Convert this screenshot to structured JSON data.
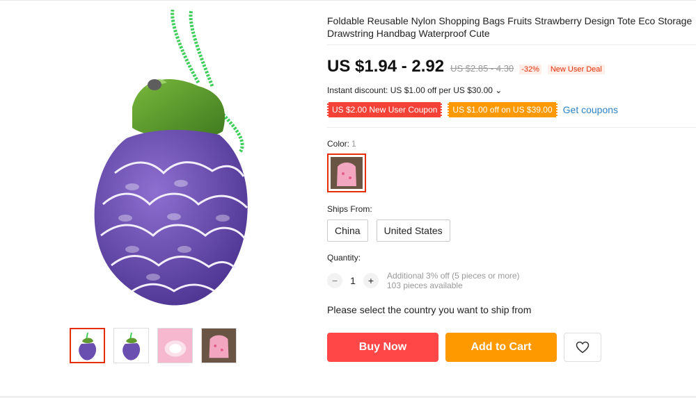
{
  "product": {
    "title": "Foldable Reusable Nylon Shopping Bags Fruits Strawberry Design Tote Eco Storage Drawstring Handbag Waterproof Cute",
    "price": "US $1.94 - 2.92",
    "old_price": "US $2.85 - 4.30",
    "discount_pct": "-32%",
    "new_user_deal": "New User Deal",
    "instant_discount": "Instant discount: US $1.00 off per US $30.00 ⌄"
  },
  "coupons": {
    "coupon1": "US $2.00 New User Coupon",
    "coupon2": "US $1.00 off on US $39.00",
    "get_coupons": "Get coupons"
  },
  "color": {
    "label": "Color:",
    "count": "1"
  },
  "ships": {
    "label": "Ships From:",
    "options": [
      "China",
      "United States"
    ]
  },
  "quantity": {
    "label": "Quantity:",
    "value": "1",
    "minus": "−",
    "plus": "+",
    "note1": "Additional 3% off (5 pieces or more)",
    "note2": "103 pieces available"
  },
  "ship_message": "Please select the country you want to ship from",
  "actions": {
    "buy_now": "Buy Now",
    "add_to_cart": "Add to Cart"
  },
  "icons": {
    "wishlist": "heart-icon",
    "dropdown": "chevron-down-icon"
  },
  "colors": {
    "accent_red": "#ff4747",
    "accent_orange": "#ff9900",
    "link_blue": "#2e83c9",
    "grape_purple": "#6b4fb0",
    "leaf_green": "#5f9a2e"
  }
}
